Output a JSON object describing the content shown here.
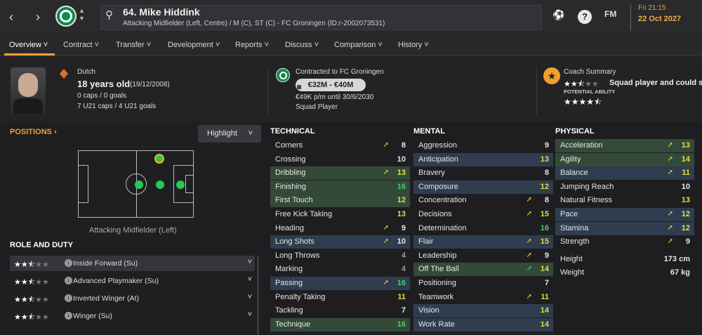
{
  "header": {
    "title": "64. Mike Hiddink",
    "subtitle": "Attacking Midfielder (Left, Centre) / M (C), ST (C) - FC Groningen (ID:r-2002073531)",
    "fm_label": "FM",
    "day_time": "Fri 21:15",
    "date": "22 Oct 2027"
  },
  "tabs": [
    "Overview",
    "Contract",
    "Transfer",
    "Development",
    "Reports",
    "Discuss",
    "Comparison",
    "History"
  ],
  "profile": {
    "nationality": "Dutch",
    "age": "18 years old",
    "dob": "(19/12/2008)",
    "caps": "0 caps / 0 goals",
    "u21": "7 U21 caps / 4 U21 goals"
  },
  "contract": {
    "title": "Contracted to FC Groningen",
    "value": "€32M - €40M",
    "wage": "€49K p/m until 30/6/2030",
    "status": "Squad Player"
  },
  "coach": {
    "title": "Coach Summary",
    "summary": "Squad player and could s",
    "potential_label": "POTENTIAL ABILITY",
    "current_stars": 2.5,
    "potential_stars": 4.5
  },
  "positions": {
    "label": "POSITIONS",
    "highlight": "Highlight",
    "caption": "Attacking Midfielder (Left)"
  },
  "roles": {
    "title": "ROLE AND DUTY",
    "items": [
      {
        "name": "Inside Forward (Su)",
        "stars": 2.5
      },
      {
        "name": "Advanced Playmaker (Su)",
        "stars": 2.5
      },
      {
        "name": "Inverted Winger (At)",
        "stars": 2.5
      },
      {
        "name": "Winger (Su)",
        "stars": 2.5
      }
    ]
  },
  "technical": {
    "title": "TECHNICAL",
    "rows": [
      [
        "Corners",
        "8"
      ],
      [
        "Crossing",
        "10"
      ],
      [
        "Dribbling",
        "13"
      ],
      [
        "Finishing",
        "16"
      ],
      [
        "First Touch",
        "12"
      ],
      [
        "Free Kick Taking",
        "13"
      ],
      [
        "Heading",
        "9"
      ],
      [
        "Long Shots",
        "10"
      ],
      [
        "Long Throws",
        "4"
      ],
      [
        "Marking",
        "4"
      ],
      [
        "Passing",
        "16"
      ],
      [
        "Penalty Taking",
        "11"
      ],
      [
        "Tackling",
        "7"
      ],
      [
        "Technique",
        "16"
      ]
    ]
  },
  "mental": {
    "title": "MENTAL",
    "rows": [
      [
        "Aggression",
        "9"
      ],
      [
        "Anticipation",
        "13"
      ],
      [
        "Bravery",
        "8"
      ],
      [
        "Composure",
        "12"
      ],
      [
        "Concentration",
        "8"
      ],
      [
        "Decisions",
        "15"
      ],
      [
        "Determination",
        "16"
      ],
      [
        "Flair",
        "15"
      ],
      [
        "Leadership",
        "9"
      ],
      [
        "Off The Ball",
        "14"
      ],
      [
        "Positioning",
        "7"
      ],
      [
        "Teamwork",
        "11"
      ],
      [
        "Vision",
        "14"
      ],
      [
        "Work Rate",
        "14"
      ]
    ]
  },
  "physical": {
    "title": "PHYSICAL",
    "rows": [
      [
        "Acceleration",
        "13"
      ],
      [
        "Agility",
        "14"
      ],
      [
        "Balance",
        "11"
      ],
      [
        "Jumping Reach",
        "10"
      ],
      [
        "Natural Fitness",
        "13"
      ],
      [
        "Pace",
        "12"
      ],
      [
        "Stamina",
        "12"
      ],
      [
        "Strength",
        "9"
      ]
    ],
    "height_label": "Height",
    "height": "173 cm",
    "weight_label": "Weight",
    "weight": "67 kg"
  },
  "colors": {
    "accent": "#f0a030",
    "green": "#3dd26a",
    "yellow": "#e6dc3c",
    "club": "#0e8a4e"
  }
}
